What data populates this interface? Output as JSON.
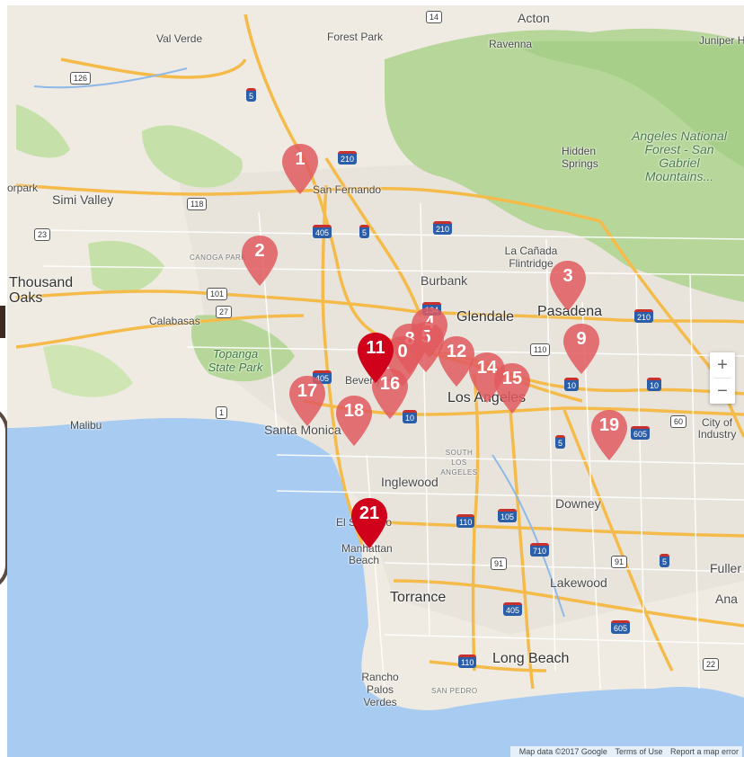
{
  "map": {
    "places": [
      {
        "id": "acton",
        "label": "Acton",
        "cls": ""
      },
      {
        "id": "val-verde",
        "label": "Val Verde",
        "cls": "small"
      },
      {
        "id": "forest-park",
        "label": "Forest Park",
        "cls": "small"
      },
      {
        "id": "ravenna",
        "label": "Ravenna",
        "cls": "small"
      },
      {
        "id": "juniper",
        "label": "Juniper H",
        "cls": "small"
      },
      {
        "id": "hidden-springs",
        "label": "Hidden Springs",
        "cls": "small"
      },
      {
        "id": "angeles-forest",
        "label": "Angeles National Forest - San Gabriel Mountains...",
        "cls": "park-big"
      },
      {
        "id": "san-fernando",
        "label": "San Fernando",
        "cls": "small"
      },
      {
        "id": "orpark",
        "label": "orpark",
        "cls": "small"
      },
      {
        "id": "simi-valley",
        "label": "Simi Valley",
        "cls": ""
      },
      {
        "id": "canoga-park",
        "label": "CANOGA PARK",
        "cls": "tiny"
      },
      {
        "id": "la-canada",
        "label": "La Cañada Flintridge",
        "cls": "small"
      },
      {
        "id": "thousand-oaks",
        "label": "Thousand Oaks",
        "cls": "big"
      },
      {
        "id": "burbank",
        "label": "Burbank",
        "cls": ""
      },
      {
        "id": "glendale",
        "label": "Glendale",
        "cls": "big"
      },
      {
        "id": "pasadena",
        "label": "Pasadena",
        "cls": "big"
      },
      {
        "id": "calabasas",
        "label": "Calabasas",
        "cls": "small"
      },
      {
        "id": "topanga",
        "label": "Topanga State Park",
        "cls": "park"
      },
      {
        "id": "beverly",
        "label": "Beverly Hills",
        "cls": "small"
      },
      {
        "id": "los-angeles",
        "label": "Los Angeles",
        "cls": "big"
      },
      {
        "id": "west",
        "label": "We",
        "cls": ""
      },
      {
        "id": "malibu",
        "label": "Malibu",
        "cls": "small"
      },
      {
        "id": "santa-monica",
        "label": "Santa Monica",
        "cls": ""
      },
      {
        "id": "city-of-industry",
        "label": "City of Industry",
        "cls": "small"
      },
      {
        "id": "south-la",
        "label": "SOUTH LOS ANGELES",
        "cls": "tiny"
      },
      {
        "id": "inglewood",
        "label": "Inglewood",
        "cls": ""
      },
      {
        "id": "downey",
        "label": "Downey",
        "cls": ""
      },
      {
        "id": "el-segundo",
        "label": "El Segundo",
        "cls": "small"
      },
      {
        "id": "manhattan-beach",
        "label": "Manhattan Beach",
        "cls": "small"
      },
      {
        "id": "fuller",
        "label": "Fuller",
        "cls": ""
      },
      {
        "id": "lakewood",
        "label": "Lakewood",
        "cls": ""
      },
      {
        "id": "ana",
        "label": "Ana",
        "cls": ""
      },
      {
        "id": "torrance",
        "label": "Torrance",
        "cls": "big"
      },
      {
        "id": "long-beach",
        "label": "Long Beach",
        "cls": "big"
      },
      {
        "id": "rancho",
        "label": "Rancho Palos Verdes",
        "cls": "small"
      },
      {
        "id": "san-pedro",
        "label": "SAN PEDRO",
        "cls": "tiny"
      }
    ],
    "shields": [
      {
        "id": "s14",
        "label": "14",
        "type": "us"
      },
      {
        "id": "s126",
        "label": "126",
        "type": "us"
      },
      {
        "id": "s5a",
        "label": "5",
        "type": "iw"
      },
      {
        "id": "s210a",
        "label": "210",
        "type": "iw"
      },
      {
        "id": "s118",
        "label": "118",
        "type": "us"
      },
      {
        "id": "s405a",
        "label": "405",
        "type": "iw"
      },
      {
        "id": "s5b",
        "label": "5",
        "type": "iw"
      },
      {
        "id": "s210b",
        "label": "210",
        "type": "iw"
      },
      {
        "id": "s23",
        "label": "23",
        "type": "us"
      },
      {
        "id": "s101",
        "label": "101",
        "type": "us"
      },
      {
        "id": "s27",
        "label": "27",
        "type": "us"
      },
      {
        "id": "s134",
        "label": "134",
        "type": "iw"
      },
      {
        "id": "s110a",
        "label": "110",
        "type": "us"
      },
      {
        "id": "s210c",
        "label": "210",
        "type": "iw"
      },
      {
        "id": "s405b",
        "label": "405",
        "type": "iw"
      },
      {
        "id": "s10a",
        "label": "10",
        "type": "iw"
      },
      {
        "id": "s10b",
        "label": "10",
        "type": "iw"
      },
      {
        "id": "s10c",
        "label": "10",
        "type": "iw"
      },
      {
        "id": "s1",
        "label": "1",
        "type": "us"
      },
      {
        "id": "s60",
        "label": "60",
        "type": "us"
      },
      {
        "id": "s605a",
        "label": "605",
        "type": "iw"
      },
      {
        "id": "s5c",
        "label": "5",
        "type": "iw"
      },
      {
        "id": "s110b",
        "label": "110",
        "type": "iw"
      },
      {
        "id": "s105",
        "label": "105",
        "type": "iw"
      },
      {
        "id": "s710",
        "label": "710",
        "type": "iw"
      },
      {
        "id": "s91a",
        "label": "91",
        "type": "us"
      },
      {
        "id": "s91b",
        "label": "91",
        "type": "us"
      },
      {
        "id": "s5d",
        "label": "5",
        "type": "iw"
      },
      {
        "id": "s405c",
        "label": "405",
        "type": "iw"
      },
      {
        "id": "s605b",
        "label": "605",
        "type": "iw"
      },
      {
        "id": "s110c",
        "label": "110",
        "type": "iw"
      },
      {
        "id": "s22",
        "label": "22",
        "type": "us"
      }
    ],
    "markers": [
      {
        "id": "m1",
        "label": "1",
        "color": "#e05a5f"
      },
      {
        "id": "m2",
        "label": "2",
        "color": "#e05a5f"
      },
      {
        "id": "m3",
        "label": "3",
        "color": "#e05a5f"
      },
      {
        "id": "m4",
        "label": "4",
        "color": "#e05a5f"
      },
      {
        "id": "m5",
        "label": "5",
        "color": "#e05a5f"
      },
      {
        "id": "m8",
        "label": "8",
        "color": "#e05a5f"
      },
      {
        "id": "m9",
        "label": "9",
        "color": "#e05a5f"
      },
      {
        "id": "m10",
        "label": "0",
        "color": "#e05a5f"
      },
      {
        "id": "m12",
        "label": "12",
        "color": "#e05a5f"
      },
      {
        "id": "m14",
        "label": "14",
        "color": "#e05a5f"
      },
      {
        "id": "m15",
        "label": "15",
        "color": "#e05a5f"
      },
      {
        "id": "m16",
        "label": "16",
        "color": "#e05a5f"
      },
      {
        "id": "m17",
        "label": "17",
        "color": "#e05a5f"
      },
      {
        "id": "m18",
        "label": "18",
        "color": "#e05a5f"
      },
      {
        "id": "m19",
        "label": "19",
        "color": "#e05a5f"
      },
      {
        "id": "m11",
        "label": "11",
        "color": "#d0021b"
      },
      {
        "id": "m21",
        "label": "21",
        "color": "#d0021b"
      }
    ],
    "zoom": {
      "in_label": "+",
      "out_label": "−"
    },
    "attribution": {
      "data": "Map data ©2017 Google",
      "terms": "Terms of Use",
      "report": "Report a map error"
    }
  }
}
